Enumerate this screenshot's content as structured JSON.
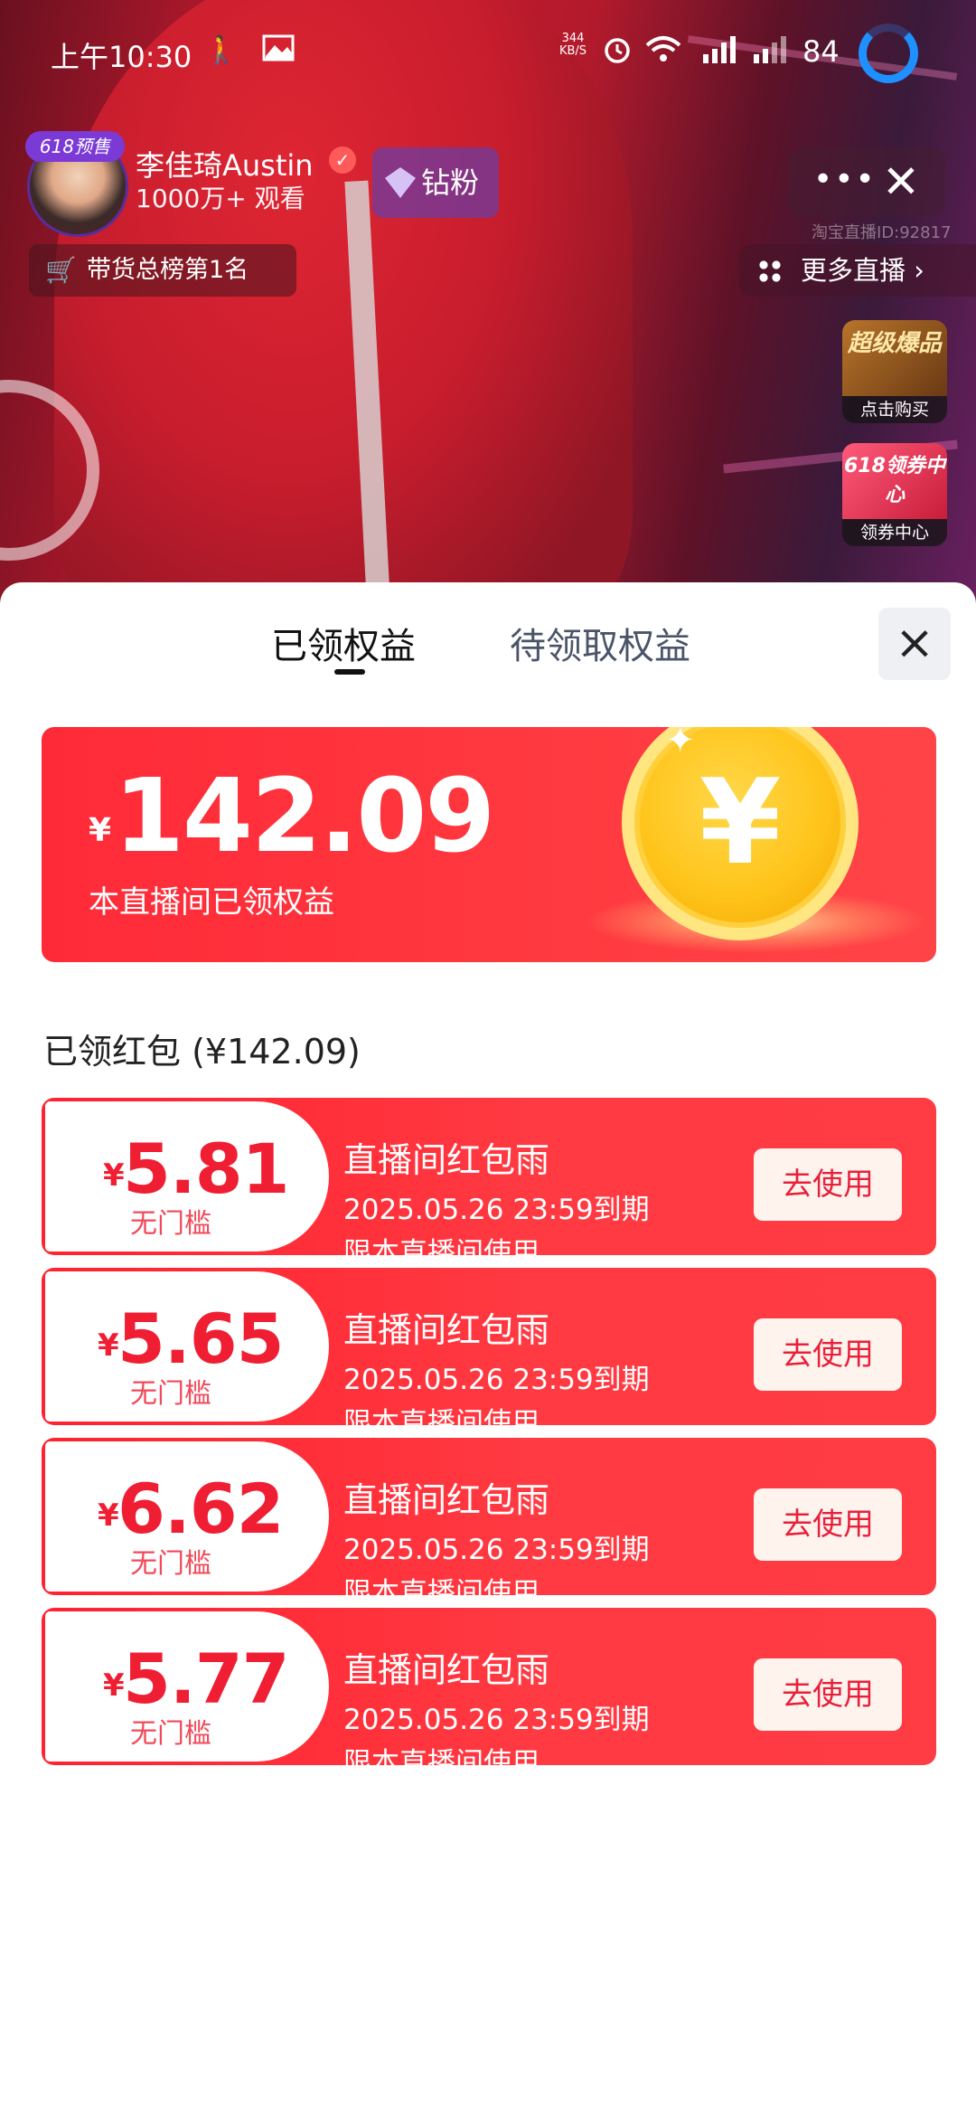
{
  "status_bar": {
    "time": "上午10:30",
    "net_speed": "344 KB/S",
    "battery": "84",
    "accent_color": "#1e90ff"
  },
  "host": {
    "badge": "618预售",
    "name": "李佳琦Austin",
    "viewers": "1000万+ 观看",
    "fan_button": "钻粉",
    "rank": "带货总榜第1名",
    "room_id": "淘宝直播ID:92817"
  },
  "top_bar": {
    "more_icon": "more-dots-icon",
    "close_icon": "close-icon",
    "more_live": "更多直播"
  },
  "promos": [
    {
      "art": "超级爆品",
      "caption": "点击购买"
    },
    {
      "art": "618领券中心",
      "caption": "领券中心"
    }
  ],
  "sheet": {
    "tabs": [
      {
        "label": "已领权益",
        "active": true
      },
      {
        "label": "待领取权益",
        "active": false
      }
    ],
    "summary": {
      "currency": "¥",
      "amount": "142.09",
      "caption": "本直播间已领权益",
      "coin_symbol": "¥"
    },
    "section_title": "已领红包 (¥142.09)",
    "coupons": [
      {
        "currency": "¥",
        "value": "5.81",
        "threshold": "无门槛",
        "title": "直播间红包雨",
        "expiry": "2025.05.26 23:59到期",
        "scope": "限本直播间使用",
        "button": "去使用"
      },
      {
        "currency": "¥",
        "value": "5.65",
        "threshold": "无门槛",
        "title": "直播间红包雨",
        "expiry": "2025.05.26 23:59到期",
        "scope": "限本直播间使用",
        "button": "去使用"
      },
      {
        "currency": "¥",
        "value": "6.62",
        "threshold": "无门槛",
        "title": "直播间红包雨",
        "expiry": "2025.05.26 23:59到期",
        "scope": "限本直播间使用",
        "button": "去使用"
      },
      {
        "currency": "¥",
        "value": "5.77",
        "threshold": "无门槛",
        "title": "直播间红包雨",
        "expiry": "2025.05.26 23:59到期",
        "scope": "限本直播间使用",
        "button": "去使用"
      }
    ]
  },
  "colors": {
    "brand_red": "#ff2a38",
    "coupon_value": "#f01e33",
    "coin_gold": "#ffc41a"
  }
}
